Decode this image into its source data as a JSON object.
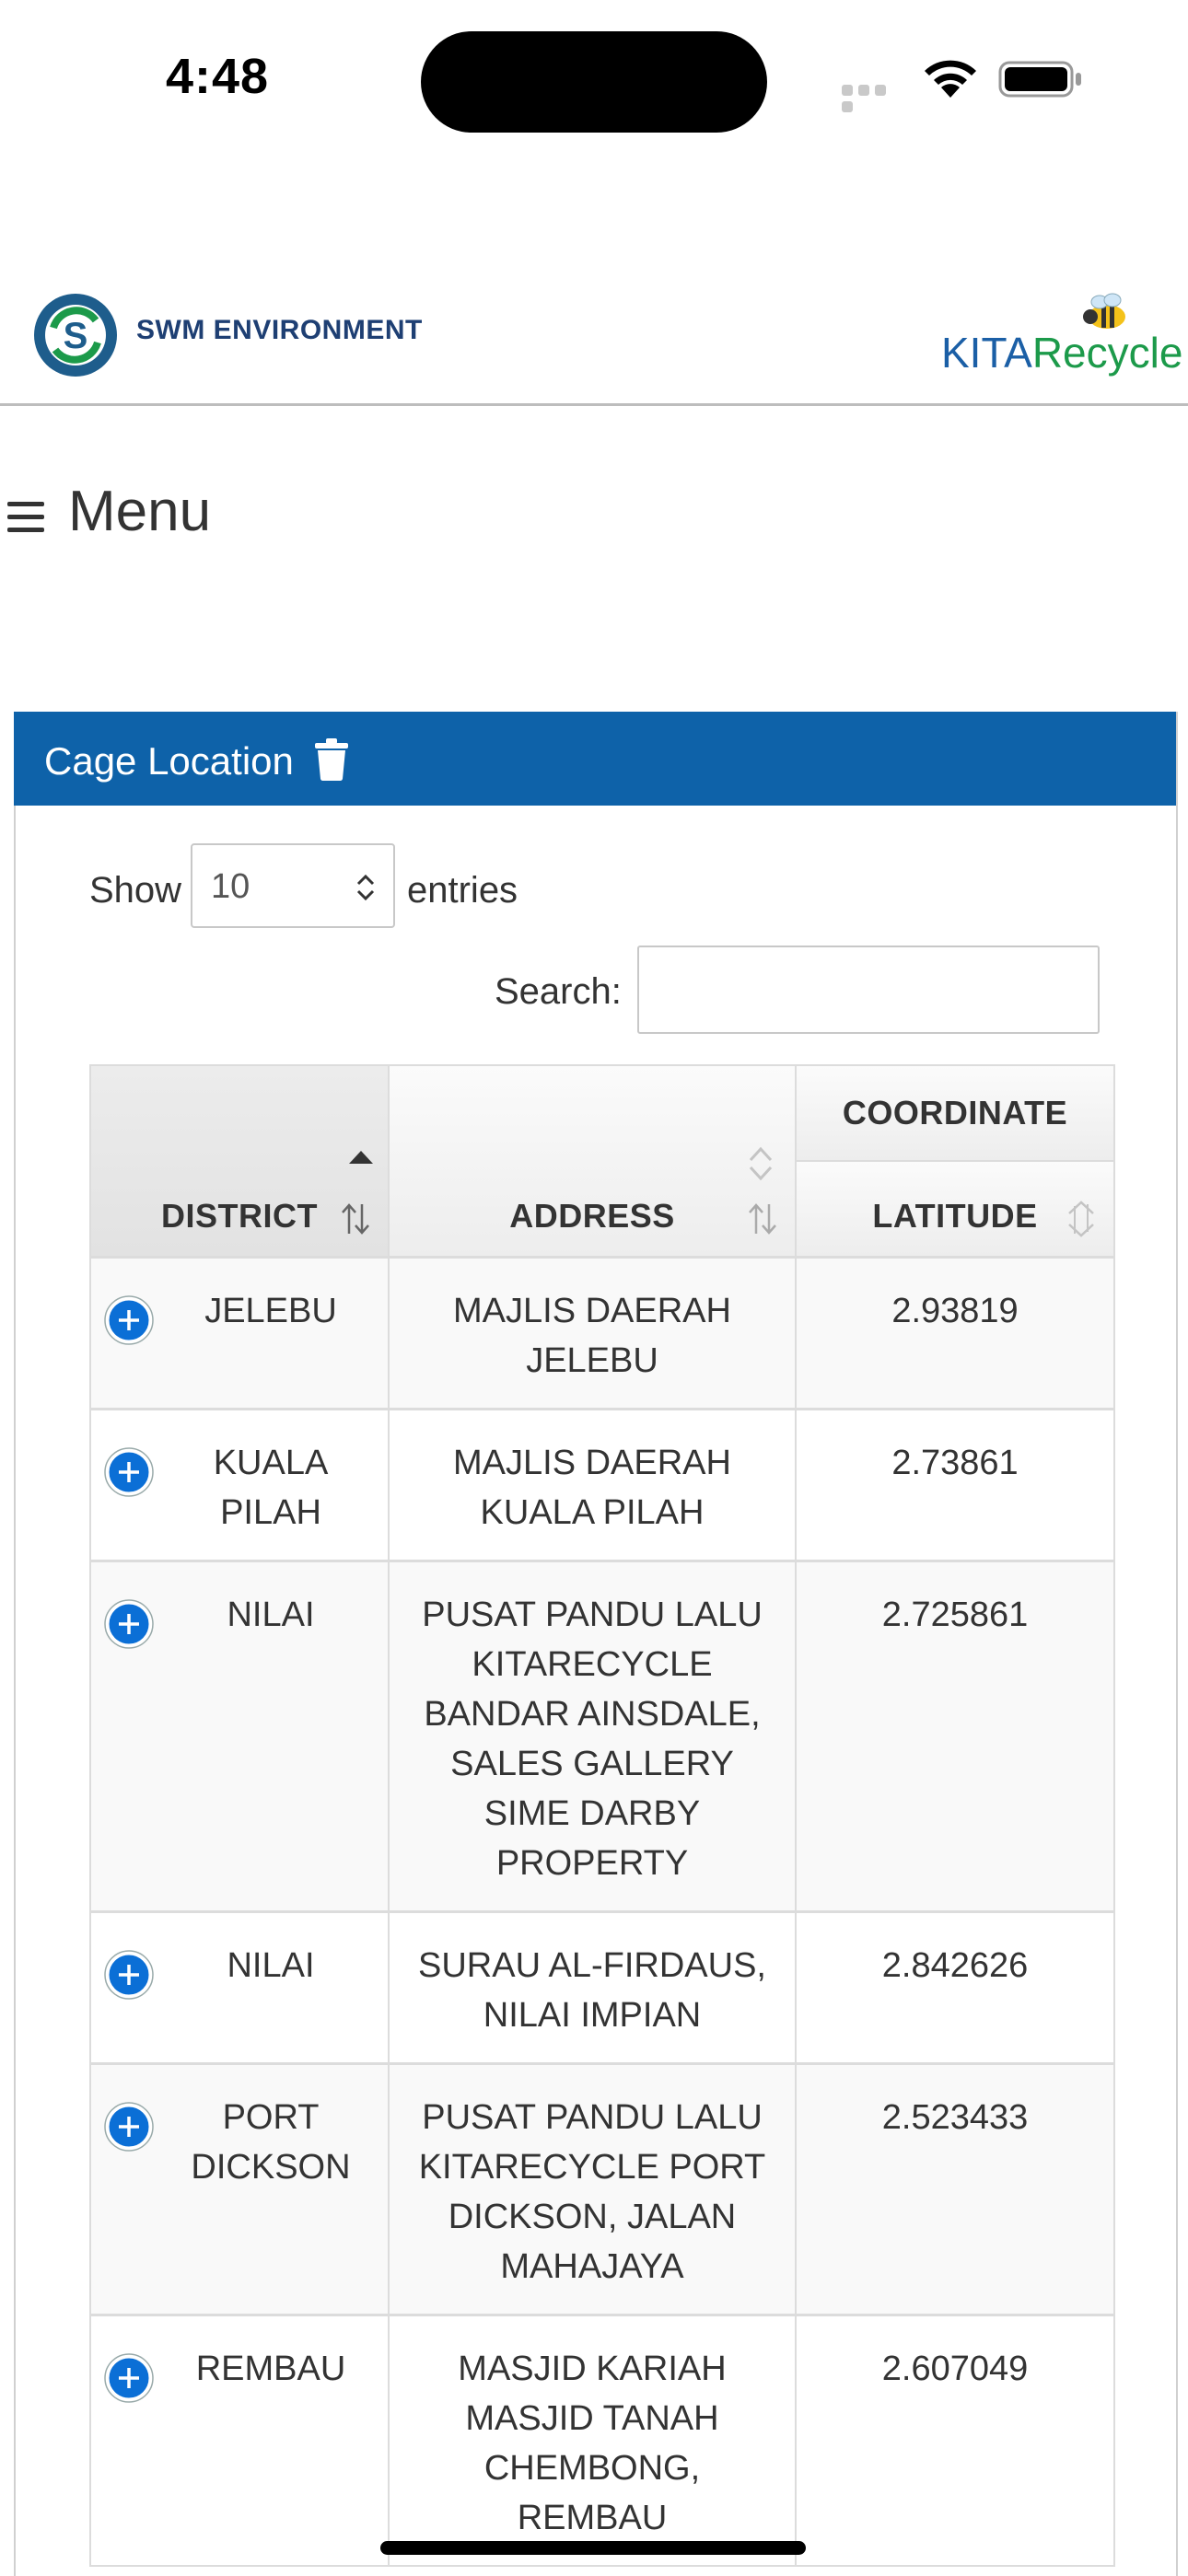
{
  "status_bar": {
    "time": "4:48"
  },
  "header": {
    "left_logo_text": "SWM ENVIRONMENT",
    "right_logo_part1": "KITA",
    "right_logo_part2": "Recycle"
  },
  "menu": {
    "label": "Menu",
    "icon": "hamburger-icon"
  },
  "panel": {
    "title": "Cage Location",
    "title_icon": "trash-icon",
    "heading_color": "#0e62a9"
  },
  "controls": {
    "show_label": "Show",
    "entries_value": "10",
    "entries_label": "entries",
    "search_label": "Search:",
    "search_value": ""
  },
  "table": {
    "group_header": "COORDINATE",
    "columns": [
      "DISTRICT",
      "ADDRESS",
      "LATITUDE"
    ],
    "rows": [
      {
        "district": "JELEBU",
        "address": "MAJLIS DAERAH JELEBU",
        "latitude": "2.93819"
      },
      {
        "district": "KUALA PILAH",
        "address": "MAJLIS DAERAH KUALA PILAH",
        "latitude": "2.73861"
      },
      {
        "district": "NILAI",
        "address": "PUSAT PANDU LALU KITARECYCLE BANDAR AINSDALE, SALES GALLERY SIME DARBY PROPERTY",
        "latitude": "2.725861"
      },
      {
        "district": "NILAI",
        "address": "SURAU AL-FIRDAUS, NILAI IMPIAN",
        "latitude": "2.842626"
      },
      {
        "district": "PORT DICKSON",
        "address": "PUSAT PANDU LALU KITARECYCLE PORT DICKSON, JALAN MAHAJAYA",
        "latitude": "2.523433"
      },
      {
        "district": "REMBAU",
        "address": "MASJID KARIAH MASJID TANAH CHEMBONG, REMBAU",
        "latitude": "2.607049"
      }
    ]
  }
}
